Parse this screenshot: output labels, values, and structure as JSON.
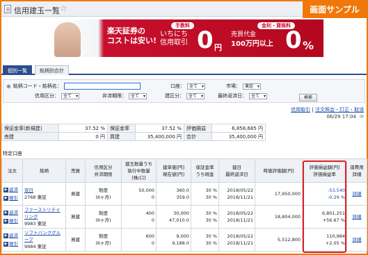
{
  "header": {
    "title": "信用建玉一覧"
  },
  "sample_badge": "画面サンプル",
  "banner": {
    "line1": "楽天証券の",
    "line2": "コストは安い!",
    "left_pill": "手数料",
    "left_text1": "いちにち",
    "left_text2": "信用取引",
    "left_zero": "0",
    "left_unit": "円",
    "right_pill": "金利・貸株料",
    "right_text1": "売買代金",
    "right_text2": "100万円以上",
    "right_zero": "0",
    "right_unit": "%"
  },
  "tabs": [
    {
      "label": "個別一覧"
    },
    {
      "label": "銘柄別合計"
    }
  ],
  "search": {
    "code_label": "銘柄コード・銘柄名：",
    "code_value": "",
    "account_label": "口座：",
    "account_value": "全て",
    "market_label": "市場：",
    "market_value": "東証",
    "credit_label": "信用区分：",
    "credit_value": "全て",
    "repay_label": "弁済期限：",
    "repay_value": "全て",
    "build_label": "建区分：",
    "build_value": "全て",
    "lastdate_label": "最終返済日：",
    "lastdate_value": "全て",
    "search_button": "検索"
  },
  "links": {
    "history": "信用取引",
    "orders": "注文照会・訂正・取消"
  },
  "timestamp": "06/29 17:04",
  "summary": [
    {
      "l1": "保証金率(新規建)",
      "v1": "37.52 %",
      "l2": "保証金率",
      "v2": "37.52 %",
      "l3": "評価損益",
      "v3": "6,858,685 円"
    },
    {
      "l1": "売建",
      "v1": "0 円",
      "l2": "買建",
      "v2": "35,400,000 円",
      "l3": "合計",
      "v3": "35,400,000 円"
    }
  ],
  "section_title": "特定口座",
  "columns": {
    "order": "注文",
    "name": "銘柄",
    "side": "売買",
    "credit": "信用区分\n弁済期限",
    "qty": "建玉数量うち\n執行中数量\n[株/口]",
    "price": "建単価[円]\n現在値[円]",
    "margin": "保証金率\nうち現金",
    "date": "建日\n最終返済日",
    "market_value": "時価評価額[円]",
    "pl": "評価損益額[円]\n評価損益率",
    "fee": "諸費用\n詳細"
  },
  "rows": [
    {
      "act1": "返済",
      "act2": "現引",
      "name": "双日",
      "code": "2768 東証",
      "side": "買建",
      "credit": "制度",
      "term": "(6ヶ月)",
      "qty": "50,000",
      "qty2": "0",
      "price": "360.0",
      "cur": "359.0",
      "m1": "30 %",
      "m2": "30 %",
      "d1": "2018/05/22",
      "d2": "2018/11/21",
      "mv": "17,950,000",
      "pl": "-53,540",
      "plr": "-0.29 %",
      "fee": "詳細"
    },
    {
      "act1": "返済",
      "act2": "現引",
      "name": "ファーストリテイリング",
      "code": "9983 東証",
      "side": "買建",
      "credit": "制度",
      "term": "(6ヶ月)",
      "qty": "400",
      "qty2": "0",
      "price": "30,000",
      "cur": "47,010.0",
      "m1": "30 %",
      "m2": "30 %",
      "d1": "2018/05/22",
      "d2": "2018/11/21",
      "mv": "18,804,000",
      "pl": "6,801,251",
      "plr": "+56.67 %",
      "fee": "詳細"
    },
    {
      "act1": "返済",
      "act2": "現引",
      "name": "ソフトバンクグループ",
      "code": "9984 東証",
      "side": "買建",
      "credit": "制度",
      "term": "(6ヶ月)",
      "qty": "600",
      "qty2": "0",
      "price": "9,000",
      "cur": "9,188.0",
      "m1": "30 %",
      "m2": "30 %",
      "d1": "2018/05/22",
      "d2": "2018/11/21",
      "mv": "5,512,800",
      "pl": "110,984",
      "plr": "+2.05 %",
      "fee": "詳細"
    }
  ]
}
